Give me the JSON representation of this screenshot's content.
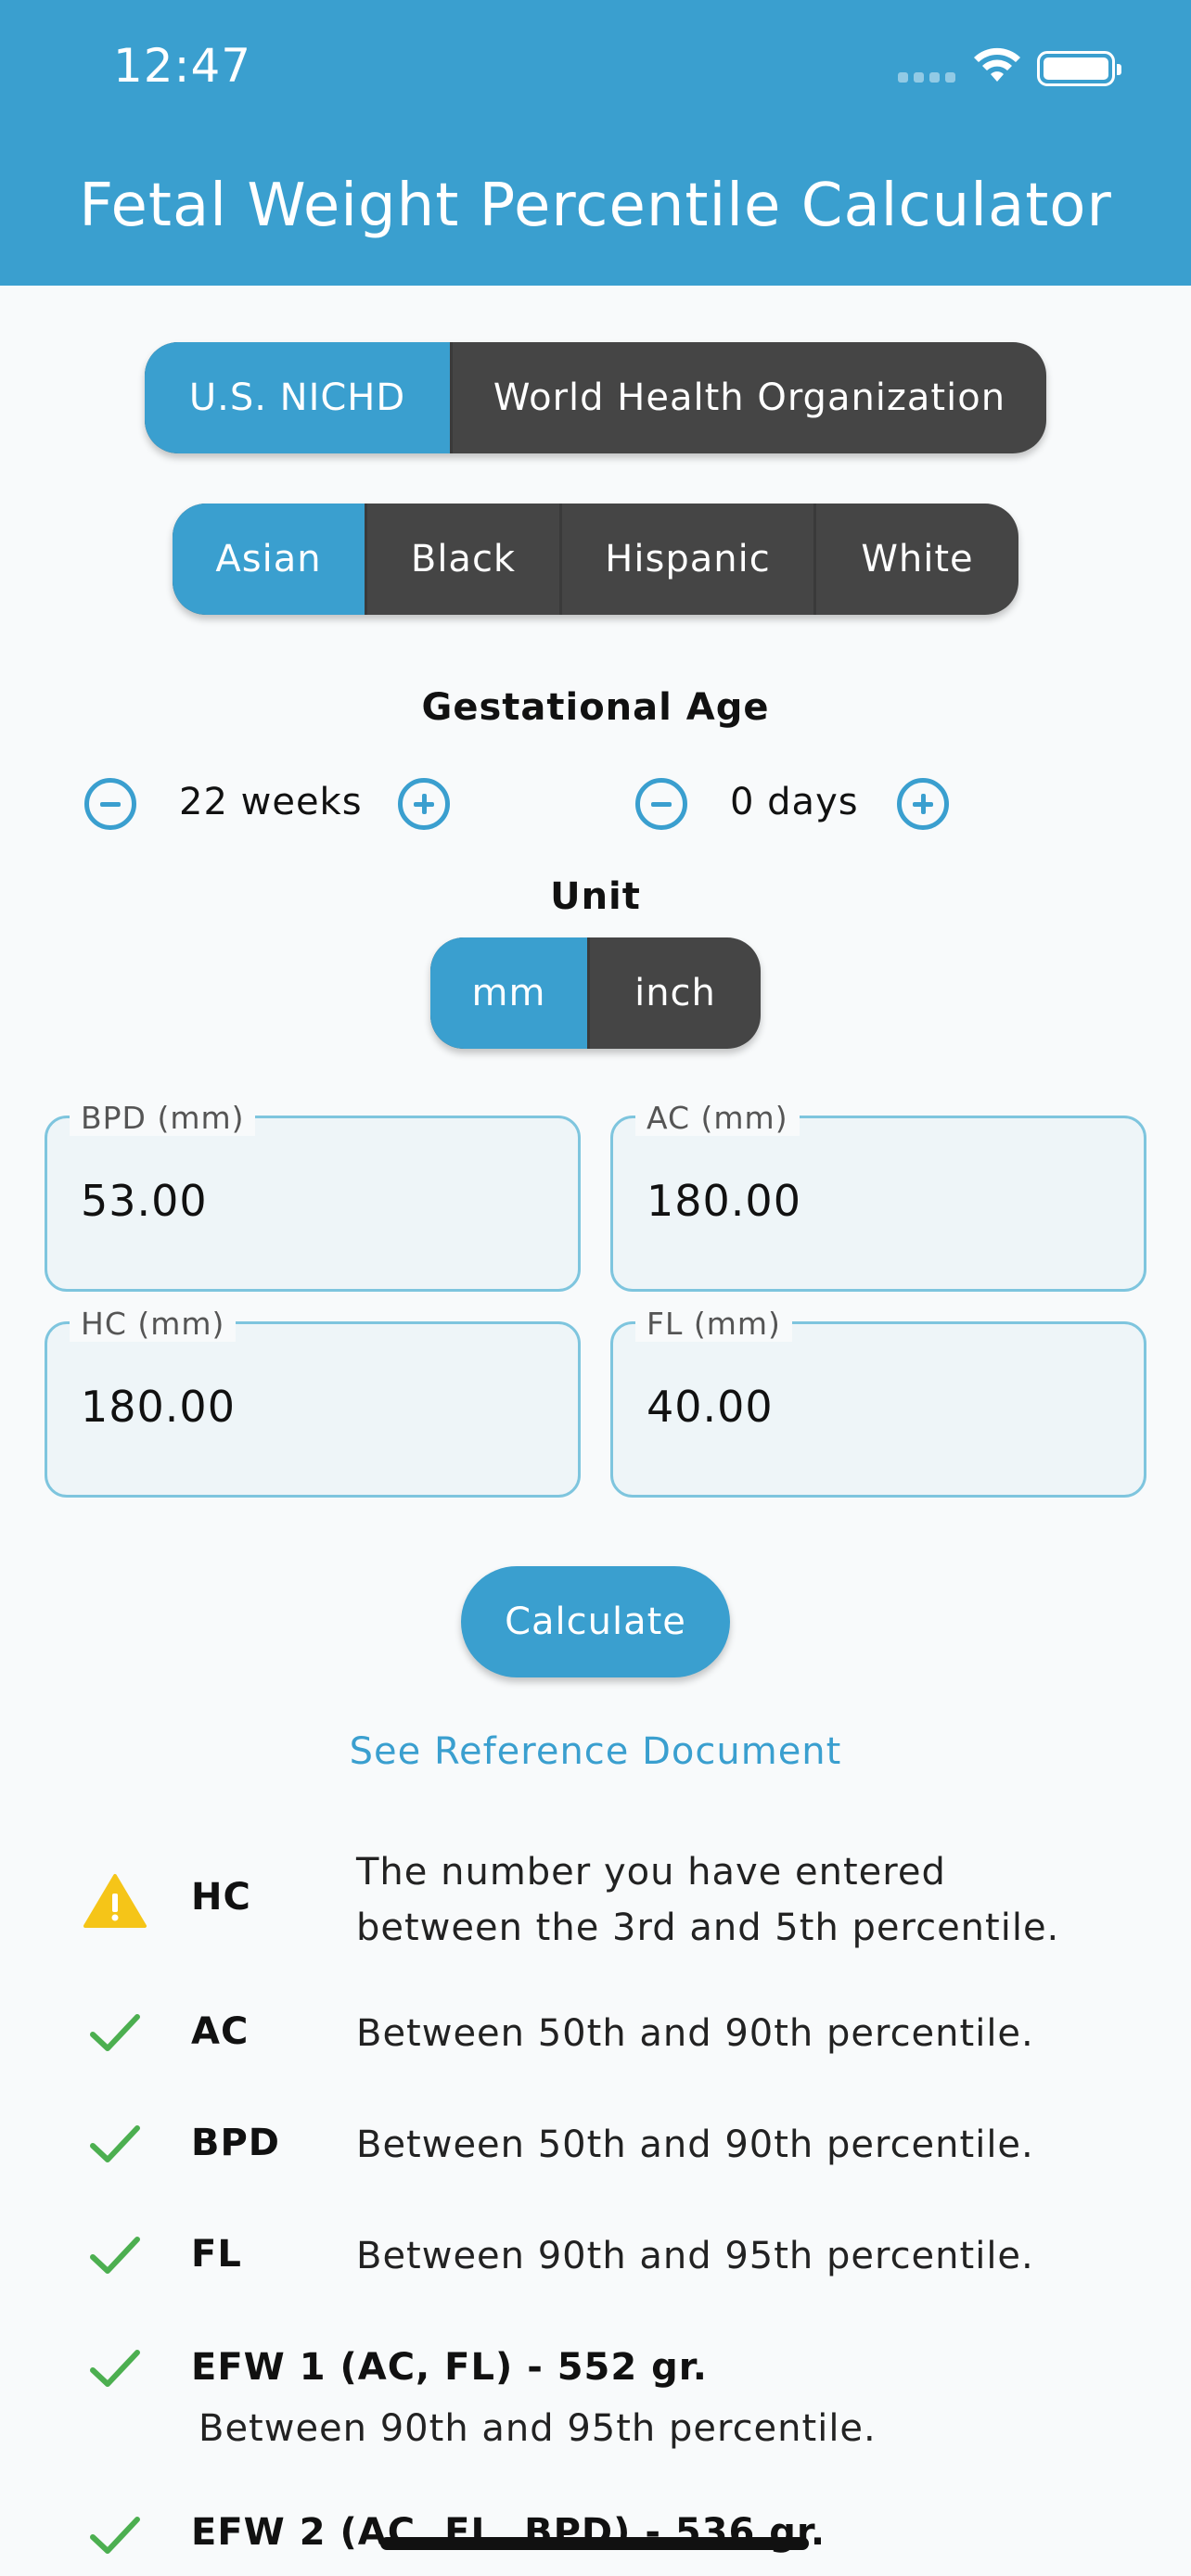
{
  "status_bar": {
    "time": "12:47"
  },
  "header": {
    "title": "Fetal Weight Percentile Calculator"
  },
  "standard": {
    "options": [
      "U.S. NICHD",
      "World Health Organization"
    ],
    "selected": "U.S. NICHD"
  },
  "ethnicity": {
    "options": [
      "Asian",
      "Black",
      "Hispanic",
      "White"
    ],
    "selected": "Asian"
  },
  "gestational_age": {
    "label": "Gestational Age",
    "weeks": "22 weeks",
    "days": "0 days"
  },
  "unit": {
    "label": "Unit",
    "options": [
      "mm",
      "inch"
    ],
    "selected": "mm"
  },
  "fields": {
    "bpd": {
      "label": "BPD (mm)",
      "value": "53.00"
    },
    "ac": {
      "label": "AC (mm)",
      "value": "180.00"
    },
    "hc": {
      "label": "HC (mm)",
      "value": "180.00"
    },
    "fl": {
      "label": "FL (mm)",
      "value": "40.00"
    }
  },
  "actions": {
    "calculate": "Calculate",
    "reference": "See Reference Document"
  },
  "results": [
    {
      "status": "warning",
      "label": "HC",
      "text_line1": "The number you have entered",
      "text_line2": "between the 3rd and 5th percentile."
    },
    {
      "status": "ok",
      "label": "AC",
      "text": "Between 50th and 90th percentile."
    },
    {
      "status": "ok",
      "label": "BPD",
      "text": "Between 50th and 90th percentile."
    },
    {
      "status": "ok",
      "label": "FL",
      "text": "Between 90th and 95th percentile."
    },
    {
      "status": "ok",
      "label": "EFW 1 (AC, FL) - 552 gr.",
      "text": "Between 90th and 95th percentile."
    },
    {
      "status": "ok",
      "label": "EFW 2 (AC, FL, BPD) - 536 gr."
    }
  ],
  "colors": {
    "accent": "#3a9fcf",
    "segment_dark": "#454545",
    "check": "#4caf50",
    "warning": "#f5c518"
  },
  "icons": {
    "warning": "warning-triangle-icon",
    "ok": "checkmark-icon",
    "minus": "minus-circle-icon",
    "plus": "plus-circle-icon"
  }
}
